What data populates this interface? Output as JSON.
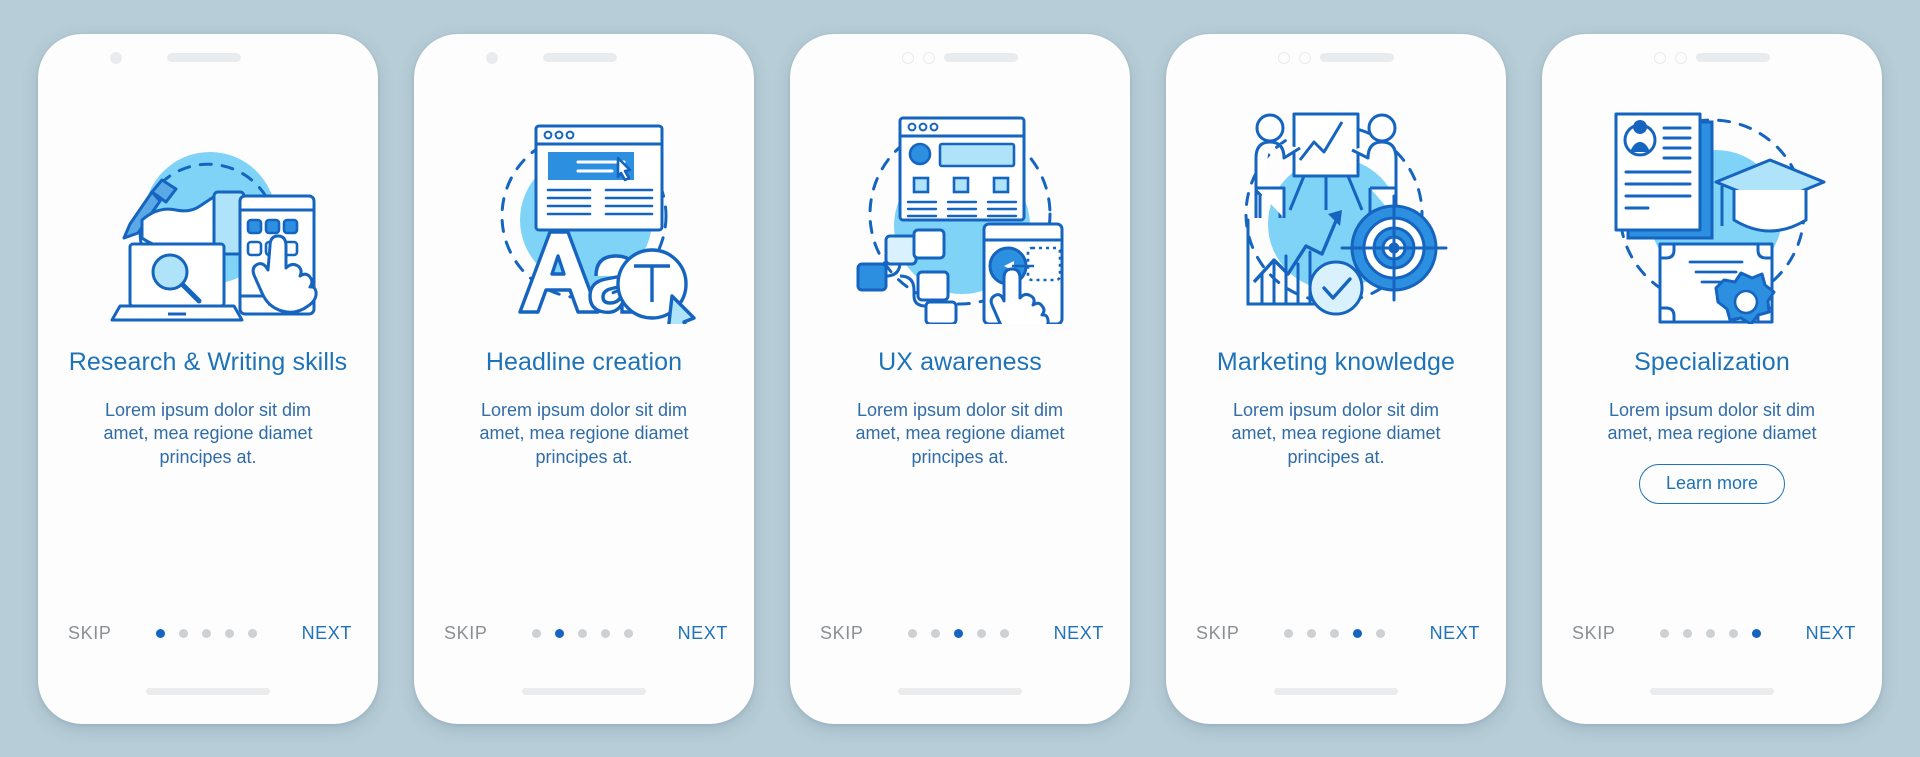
{
  "background_color": "#b7cdd7",
  "accent_color": "#1e73b8",
  "active_dot_color": "#1565c0",
  "inactive_dot_color": "#cdd1d4",
  "skip_color": "#8b8f93",
  "common": {
    "skip_label": "SKIP",
    "next_label": "NEXT",
    "description": "Lorem ipsum dolor sit dim amet, mea regione diamet principes at.",
    "description_short": "Lorem ipsum dolor sit dim amet, mea regione diamet",
    "total_steps": 5
  },
  "screens": [
    {
      "index": 1,
      "title": "Research & Writing skills",
      "description": "Lorem ipsum dolor sit dim amet, mea regione diamet principes at.",
      "skip_label": "SKIP",
      "next_label": "NEXT",
      "active_step": 1,
      "illustration": "hand-pencil-laptop-magnifier-tablet-icon",
      "header_style": "single-dot",
      "has_learn_more": false,
      "learn_more_label": ""
    },
    {
      "index": 2,
      "title": "Headline creation",
      "description": "Lorem ipsum dolor sit dim amet, mea regione diamet principes at.",
      "skip_label": "SKIP",
      "next_label": "NEXT",
      "active_step": 2,
      "illustration": "typography-browser-window-icon",
      "header_style": "single-dot",
      "has_learn_more": false,
      "learn_more_label": ""
    },
    {
      "index": 3,
      "title": "UX awareness",
      "description": "Lorem ipsum dolor sit dim amet, mea regione diamet principes at.",
      "skip_label": "SKIP",
      "next_label": "NEXT",
      "active_step": 3,
      "illustration": "wireframe-flowchart-mobile-tap-icon",
      "header_style": "double-ring",
      "has_learn_more": false,
      "learn_more_label": ""
    },
    {
      "index": 4,
      "title": "Marketing knowledge",
      "description": "Lorem ipsum dolor sit dim amet, mea regione diamet principes at.",
      "skip_label": "SKIP",
      "next_label": "NEXT",
      "active_step": 4,
      "illustration": "presentation-chart-target-icon",
      "header_style": "double-ring",
      "has_learn_more": false,
      "learn_more_label": ""
    },
    {
      "index": 5,
      "title": "Specialization",
      "description": "Lorem ipsum dolor sit dim amet, mea regione diamet",
      "skip_label": "SKIP",
      "next_label": "NEXT",
      "active_step": 5,
      "illustration": "resume-graduation-cap-certificate-icon",
      "header_style": "double-ring",
      "has_learn_more": true,
      "learn_more_label": "Learn more"
    }
  ]
}
